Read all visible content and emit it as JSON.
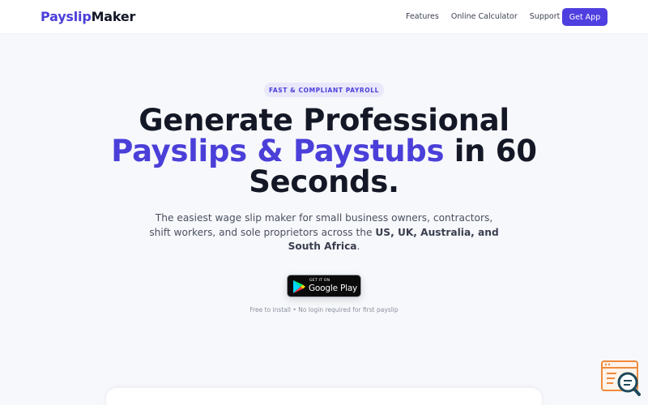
{
  "header": {
    "logo_part1": "Payslip",
    "logo_part2": "Maker",
    "nav": [
      "Features",
      "Online Calculator",
      "Support"
    ],
    "cta": "Get App"
  },
  "hero": {
    "badge": "FAST & COMPLIANT PAYROLL",
    "headline_line1": "Generate Professional",
    "headline_accent": "Payslips & Paystubs",
    "headline_after_accent": " in 60",
    "headline_line3": "Seconds.",
    "subtitle_text": "The easiest wage slip maker for small business owners, contractors, shift workers, and sole proprietors across the ",
    "subtitle_bold": "US, UK, Australia, and South Africa",
    "subtitle_end": ".",
    "store_small": "GET IT ON",
    "store_big": "Google Play",
    "fineprint": "Free to install • No login required for first payslip"
  },
  "colors": {
    "brand": "#4b3fd9",
    "button": "#4f3fe0",
    "text": "#141826"
  },
  "icons": {
    "store": "google-play-icon",
    "widget": "search-chat-icon"
  }
}
